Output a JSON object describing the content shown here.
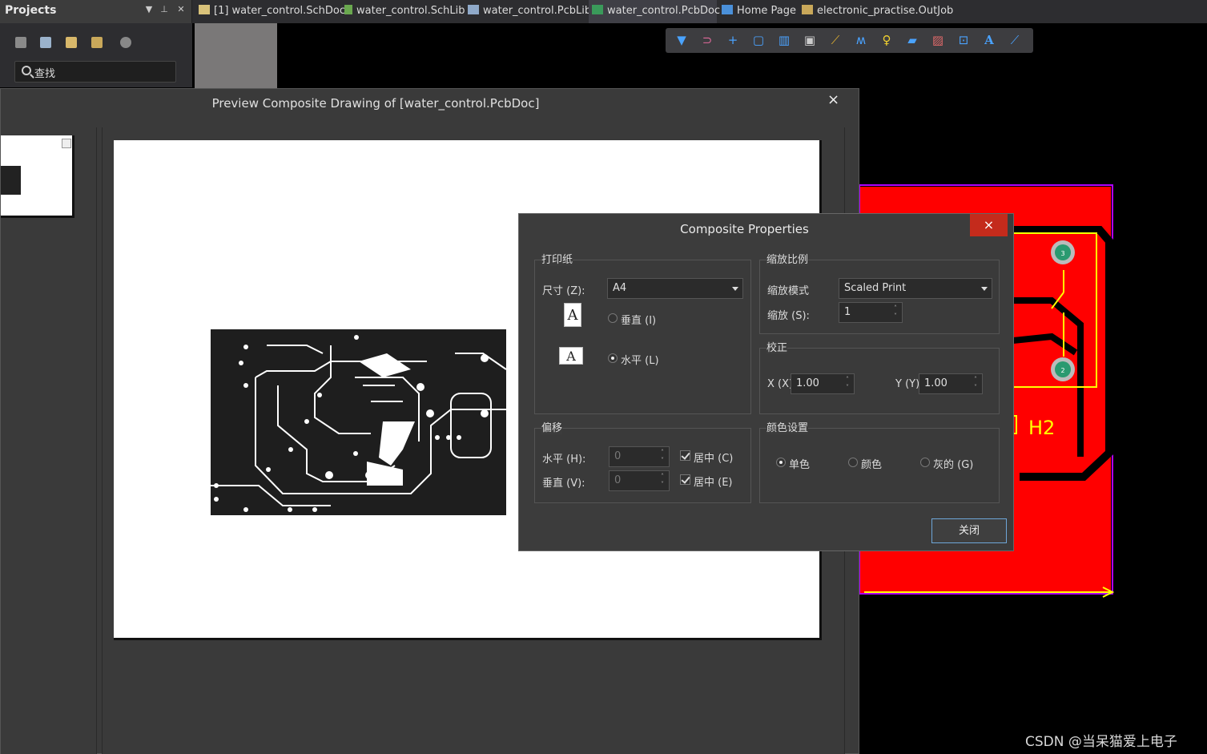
{
  "projects_panel": {
    "title": "Projects",
    "search_placeholder": "查找"
  },
  "tabs": [
    {
      "label": "[1] water_control.SchDoc"
    },
    {
      "label": "water_control.SchLib"
    },
    {
      "label": "water_control.PcbLib"
    },
    {
      "label": "water_control.PcbDoc"
    },
    {
      "label": "Home Page"
    },
    {
      "label": "electronic_practise.OutJob"
    }
  ],
  "pcb": {
    "designator": "H2",
    "pad_top_label": "3",
    "pad_bottom_label": "2"
  },
  "preview_window": {
    "title": "Preview Composite Drawing of [water_control.PcbDoc]",
    "close": "×"
  },
  "dialog": {
    "title": "Composite Properties",
    "close": "×",
    "paper_group": "打印纸",
    "size_label": "尺寸 (Z):",
    "size_value": "A4",
    "portrait_label": "垂直 (I)",
    "landscape_label": "水平 (L)",
    "orientation_letter": "A",
    "scale_group": "缩放比例",
    "scale_mode_label": "缩放模式",
    "scale_mode_value": "Scaled Print",
    "scale_label": "缩放 (S):",
    "scale_value": "1",
    "correction_group": "校正",
    "x_label": "X (X)",
    "x_value": "1.00",
    "y_label": "Y (Y)",
    "y_value": "1.00",
    "offset_group": "偏移",
    "horizontal_label": "水平 (H):",
    "horizontal_value": "0",
    "vertical_label": "垂直 (V):",
    "vertical_value": "0",
    "center_c_label": "居中 (C)",
    "center_e_label": "居中 (E)",
    "color_group": "颜色设置",
    "mono_label": "单色",
    "color_label": "颜色",
    "gray_label": "灰的 (G)",
    "close_button": "关闭"
  },
  "watermark": "CSDN @当呆猫爱上电子"
}
